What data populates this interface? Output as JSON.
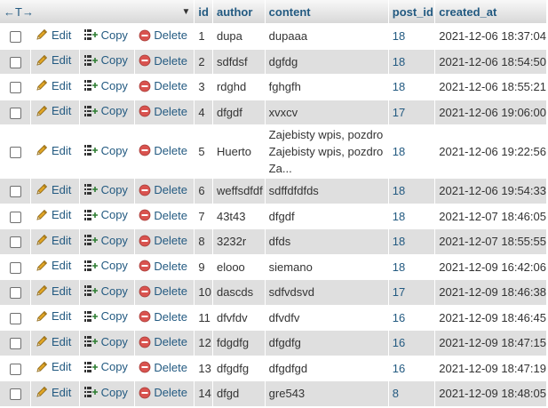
{
  "header": {
    "nav_arrows": "←T→",
    "sort_glyph": "▼",
    "columns": [
      "id",
      "author",
      "content",
      "post_id",
      "created_at"
    ]
  },
  "actions": {
    "edit": "Edit",
    "copy": "Copy",
    "delete": "Delete"
  },
  "colors": {
    "link": "#235a81",
    "row_alt": "#dfdfdf",
    "delete_red": "#d9534f",
    "pencil": "#e0a526"
  },
  "rows": [
    {
      "id": "1",
      "author": "dupa",
      "content": "dupaaa",
      "post_id": "18",
      "created_at": "2021-12-06 18:37:04"
    },
    {
      "id": "2",
      "author": "sdfdsf",
      "content": "dgfdg",
      "post_id": "18",
      "created_at": "2021-12-06 18:54:50"
    },
    {
      "id": "3",
      "author": "rdghd",
      "content": "fghgfh",
      "post_id": "18",
      "created_at": "2021-12-06 18:55:21"
    },
    {
      "id": "4",
      "author": "dfgdf",
      "content": "xvxcv",
      "post_id": "17",
      "created_at": "2021-12-06 19:06:00"
    },
    {
      "id": "5",
      "author": "Huerto",
      "content": "Zajebisty wpis, pozdro Zajebisty wpis, pozdro Za...",
      "post_id": "18",
      "created_at": "2021-12-06 19:22:56"
    },
    {
      "id": "6",
      "author": "weffsdfdf",
      "content": "sdffdfdfds",
      "post_id": "18",
      "created_at": "2021-12-06 19:54:33"
    },
    {
      "id": "7",
      "author": "43t43",
      "content": "dfgdf",
      "post_id": "18",
      "created_at": "2021-12-07 18:46:05"
    },
    {
      "id": "8",
      "author": "3232r",
      "content": "dfds",
      "post_id": "18",
      "created_at": "2021-12-07 18:55:55"
    },
    {
      "id": "9",
      "author": "elooo",
      "content": "siemano",
      "post_id": "18",
      "created_at": "2021-12-09 16:42:06"
    },
    {
      "id": "10",
      "author": "dascds",
      "content": "sdfvdsvd",
      "post_id": "17",
      "created_at": "2021-12-09 18:46:38"
    },
    {
      "id": "11",
      "author": "dfvfdv",
      "content": "dfvdfv",
      "post_id": "16",
      "created_at": "2021-12-09 18:46:45"
    },
    {
      "id": "12",
      "author": "fdgdfg",
      "content": "dfgdfg",
      "post_id": "16",
      "created_at": "2021-12-09 18:47:15"
    },
    {
      "id": "13",
      "author": "dfgdfg",
      "content": "dfgdfgd",
      "post_id": "16",
      "created_at": "2021-12-09 18:47:19"
    },
    {
      "id": "14",
      "author": "dfgd",
      "content": "gre543",
      "post_id": "8",
      "created_at": "2021-12-09 18:48:05"
    }
  ]
}
